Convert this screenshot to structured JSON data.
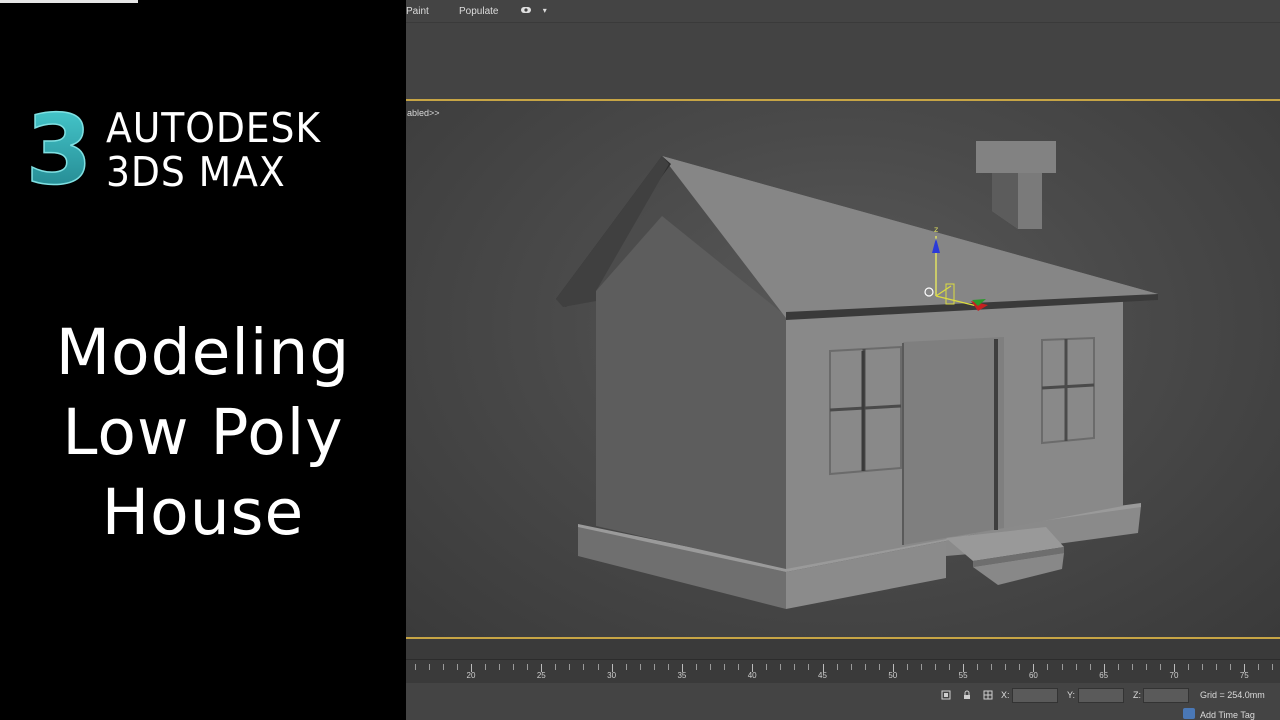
{
  "branding": {
    "app_name_line1": "AUTODESK",
    "app_name_line2": "3DS MAX",
    "logo_glyph": "3"
  },
  "headline": {
    "line1": "Modeling",
    "line2": "Low Poly",
    "line3": "House"
  },
  "menubar": {
    "item_paint": "Paint",
    "item_populate": "Populate",
    "dropdown_glyph": "▾"
  },
  "viewport": {
    "label": "abled>>",
    "gizmo_axis_label": "z"
  },
  "timeline": {
    "tick_labels": [
      "20",
      "25",
      "30",
      "35",
      "40",
      "45",
      "50",
      "55",
      "60",
      "65",
      "70",
      "75"
    ]
  },
  "statusbar": {
    "x_label": "X:",
    "y_label": "Y:",
    "z_label": "Z:",
    "grid_text": "Grid = 254.0mm",
    "add_time_tag": "Add Time Tag"
  },
  "colors": {
    "viewport_border": "#c7a545",
    "logo_teal": "#3ab9bf",
    "background_black": "#000000"
  }
}
